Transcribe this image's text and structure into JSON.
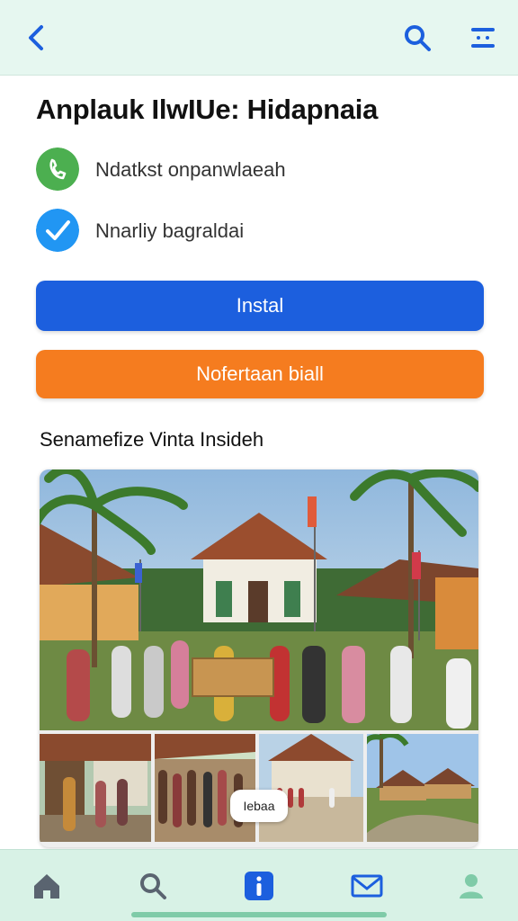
{
  "header": {
    "back_icon": "chevron-left-icon",
    "search_icon": "search-icon",
    "menu_icon": "menu-icon",
    "accent": "#1c5fde",
    "background": "#e6f7f0"
  },
  "app": {
    "title": "Anplauk IlwIUe: Hidapnaia",
    "info": [
      {
        "icon": "phone-icon",
        "icon_color": "#4caf50",
        "text": "Ndatkst onpanwlaeah"
      },
      {
        "icon": "check-icon",
        "icon_color": "#2196f3",
        "text": "Nnarliy bagraldai"
      }
    ]
  },
  "buttons": {
    "install_label": "Instal",
    "install_color": "#1c5fde",
    "more_label": "Nofertaan biall",
    "more_color": "#f57c1f"
  },
  "gallery": {
    "title": "Senamefize Vinta Insideh",
    "badge": "Iebaa"
  },
  "bottom_nav": {
    "items": [
      {
        "icon": "home-icon"
      },
      {
        "icon": "search-icon"
      },
      {
        "icon": "info-icon",
        "active": true
      },
      {
        "icon": "mail-icon"
      },
      {
        "icon": "profile-icon"
      }
    ],
    "background": "#d8f2e6"
  }
}
